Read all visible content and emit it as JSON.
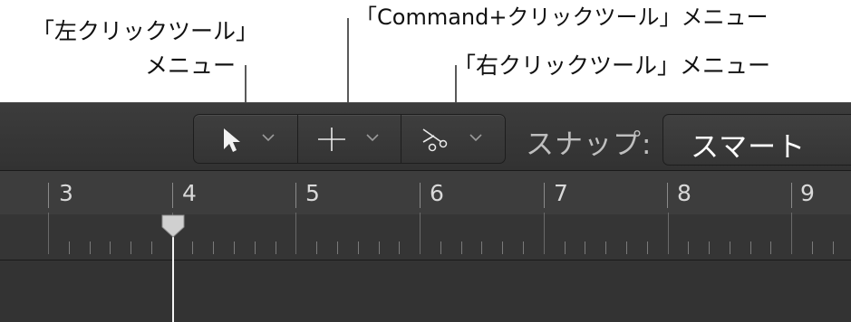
{
  "callouts": {
    "left_click_line1": "「左クリックツール」",
    "left_click_line2": "メニュー",
    "command_click": "「Command+クリックツール」メニュー",
    "right_click": "「右クリックツール」メニュー"
  },
  "toolbar": {
    "tools": [
      {
        "name": "pointer-tool-menu",
        "icon": "pointer-icon"
      },
      {
        "name": "marquee-tool-menu",
        "icon": "crosshair-icon"
      },
      {
        "name": "scissors-tool-menu",
        "icon": "scissors-icon"
      }
    ],
    "snap_label": "スナップ:",
    "snap_value": "スマート"
  },
  "ruler": {
    "bars": [
      "3",
      "4",
      "5",
      "6",
      "7",
      "8",
      "9"
    ]
  },
  "colors": {
    "panel": "#3a3a3a",
    "ruler": "#3d3d3d",
    "playhead": "#f4f4f4"
  }
}
